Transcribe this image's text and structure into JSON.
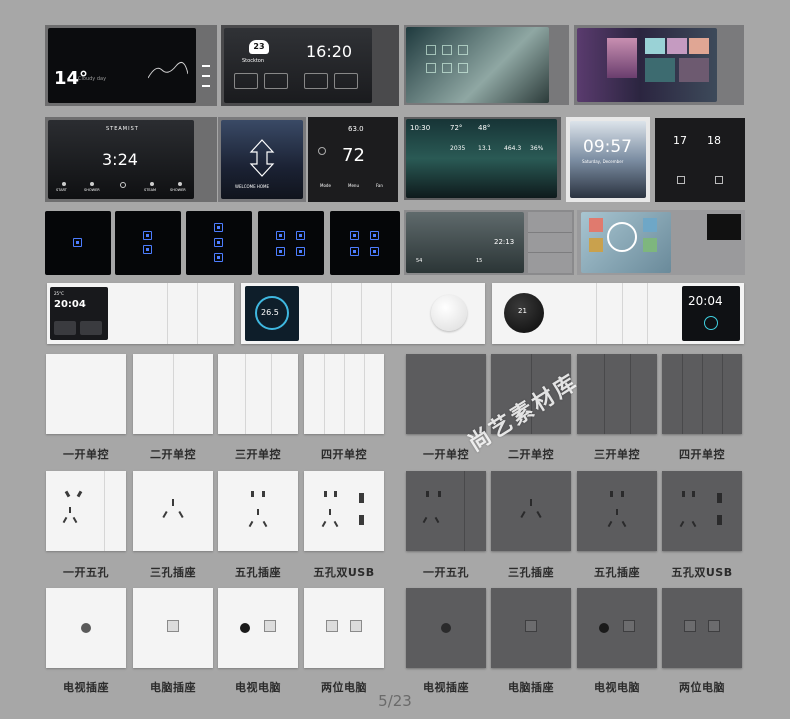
{
  "row1": {
    "temp": "14°",
    "weather_sub": "Cloudy day",
    "clock_a": "16:20",
    "date_badge": "23",
    "location": "Stockton"
  },
  "row2": {
    "brand": "STEAMIST",
    "clock_b": "3:24",
    "steam_labels": [
      "START",
      "SHOWER",
      "",
      "STEAM",
      "SHOWER"
    ],
    "welcome": "WELCOME HOME",
    "thermo_value": "72",
    "thermo_top": "63.0",
    "thermo_buttons": [
      "Mode",
      "Menu",
      "Fan"
    ],
    "time_small": "10:30",
    "stats_top": [
      "72°",
      "48°"
    ],
    "stats_bottom": [
      "2035",
      "13.1",
      "464.3",
      "36%"
    ],
    "clock_c": "09:57",
    "date_c": "Saturday, December",
    "dial_values": [
      "17",
      "18"
    ]
  },
  "row3": {
    "hub_time": "22:13",
    "hub_small": [
      "54",
      "15"
    ]
  },
  "row4": {
    "time_a": "20:04",
    "date_a": "25°C",
    "therm_value": "26.5",
    "knob_value": "21",
    "time_b": "20:04"
  },
  "switch_labels_white": [
    "一开单控",
    "二开单控",
    "三开单控",
    "四开单控"
  ],
  "switch_labels_gray": [
    "一开单控",
    "二开单控",
    "三开单控",
    "四开单控"
  ],
  "socket_labels_white": [
    "一开五孔",
    "三孔插座",
    "五孔插座",
    "五孔双USB"
  ],
  "socket_labels_gray": [
    "一开五孔",
    "三孔插座",
    "五孔插座",
    "五孔双USB"
  ],
  "data_labels_white": [
    "电视插座",
    "电脑插座",
    "电视电脑",
    "两位电脑"
  ],
  "data_labels_gray": [
    "电视插座",
    "电脑插座",
    "电视电脑",
    "两位电脑"
  ],
  "watermark": "尚艺素材库",
  "page_indicator": "5/23",
  "colors": {
    "background": "#a7a7a7",
    "gray_panel": "#5c5c5e",
    "white_panel": "#f4f4f4",
    "led_blue": "#4d7dff",
    "screen": "#141416"
  }
}
